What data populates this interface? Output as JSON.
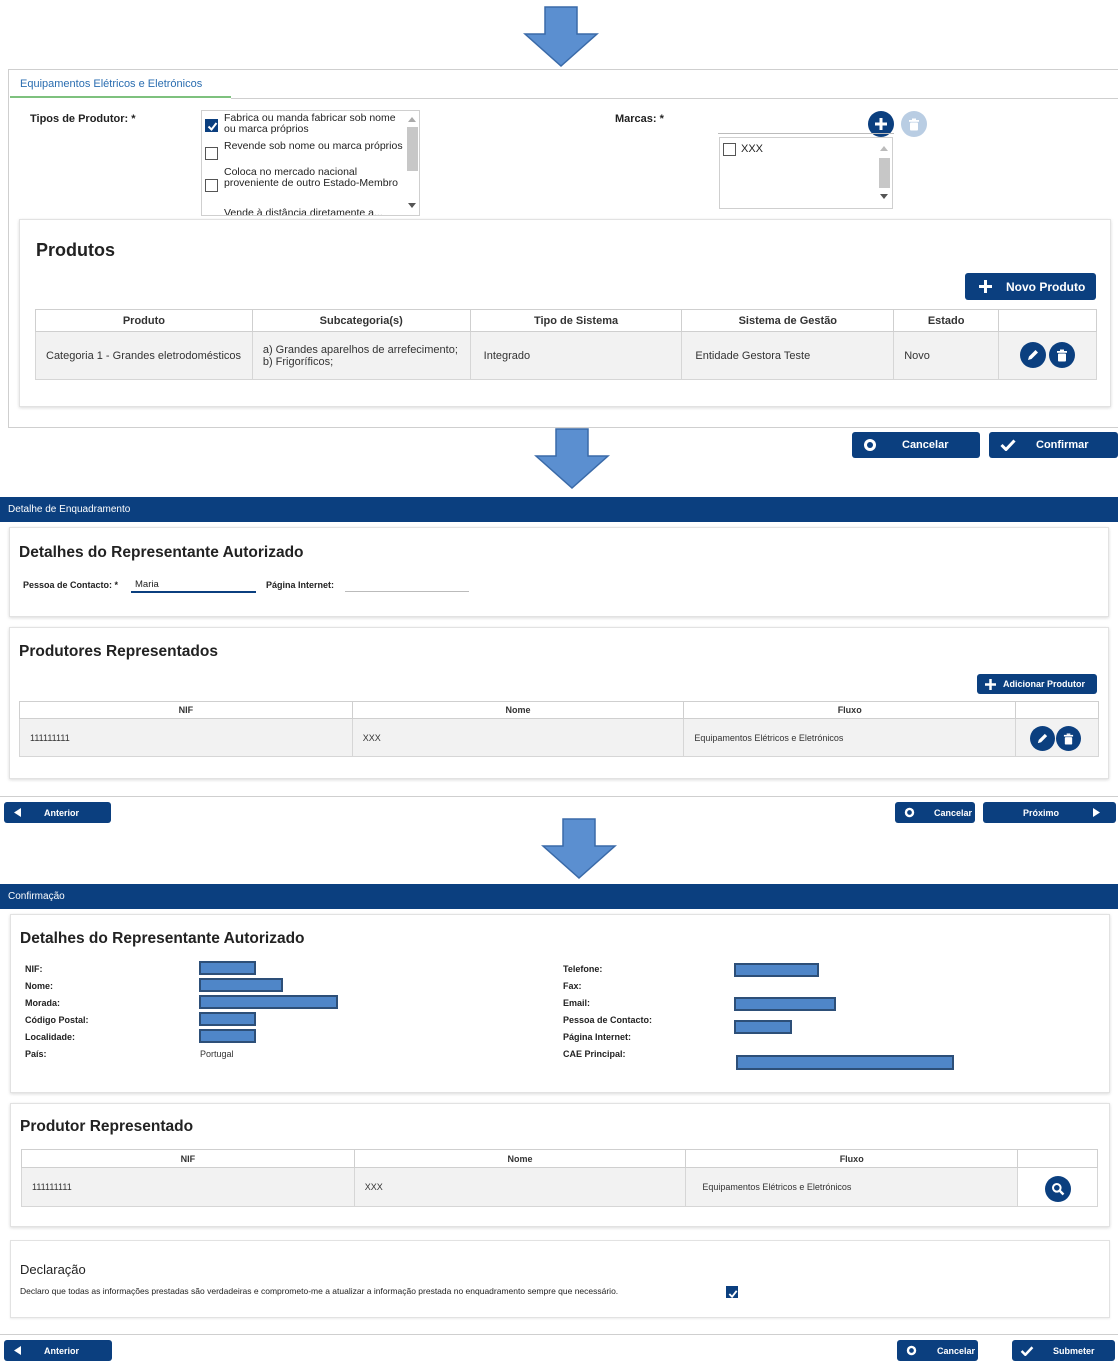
{
  "colors": {
    "navy": "#0b3f7f",
    "arrow": "#5b8fd0",
    "redaction": "#4f86c8"
  },
  "step1": {
    "tab_label": "Equipamentos Elétricos e Eletrónicos",
    "tipos_label": "Tipos de Produtor: *",
    "tipos_options": [
      {
        "text": "Fabrica ou manda fabricar sob nome ou marca próprios",
        "checked": true
      },
      {
        "text": "Revende sob nome ou marca próprios",
        "checked": false
      },
      {
        "text": "Coloca no mercado nacional proveniente de outro Estado-Membro",
        "checked": false
      },
      {
        "text": "Vende à distância diretamente a...",
        "checked": false
      }
    ],
    "marcas_label": "Marcas: *",
    "marcas_items": [
      "XXX"
    ],
    "produtos_title": "Produtos",
    "novo_produto_label": "Novo Produto",
    "produtos_table": {
      "headers": [
        "Produto",
        "Subcategoria(s)",
        "Tipo de Sistema",
        "Sistema de Gestão",
        "Estado"
      ],
      "rows": [
        [
          "Categoria 1 - Grandes eletrodomésticos",
          "a) Grandes aparelhos de arrefecimento; b) Frigoríficos;",
          "Integrado",
          "Entidade Gestora Teste",
          "Novo"
        ]
      ]
    },
    "cancelar_label": "Cancelar",
    "confirmar_label": "Confirmar"
  },
  "step2": {
    "bar_title": "Detalhe de Enquadramento",
    "rep_title": "Detalhes do Representante Autorizado",
    "contacto_label": "Pessoa de Contacto: *",
    "contacto_value": "Maria",
    "pagina_label": "Página Internet:",
    "pagina_value": "",
    "produtores_title": "Produtores Representados",
    "adicionar_label": "Adicionar Produtor",
    "table": {
      "headers": [
        "NIF",
        "Nome",
        "Fluxo"
      ],
      "rows": [
        [
          "111111111",
          "XXX",
          "Equipamentos Elétricos e Eletrónicos"
        ]
      ]
    },
    "anterior_label": "Anterior",
    "cancelar_label": "Cancelar",
    "proximo_label": "Próximo"
  },
  "step3": {
    "bar_title": "Confirmação",
    "rep_title": "Detalhes do Representante Autorizado",
    "left_labels": [
      "NIF:",
      "Nome:",
      "Morada:",
      "Código Postal:",
      "Localidade:",
      "País:"
    ],
    "pais_value": "Portugal",
    "right_labels": [
      "Telefone:",
      "Fax:",
      "Email:",
      "Pessoa de Contacto:",
      "Página Internet:",
      "CAE Principal:"
    ],
    "produtor_title": "Produtor Representado",
    "table": {
      "headers": [
        "NIF",
        "Nome",
        "Fluxo"
      ],
      "rows": [
        [
          "111111111",
          "XXX",
          "Equipamentos Elétricos e Eletrónicos"
        ]
      ]
    },
    "declaracao_title": "Declaração",
    "declaracao_text": "Declaro que todas as informações prestadas são verdadeiras e comprometo-me a atualizar a informação prestada no enquadramento sempre que necessário.",
    "declaracao_checked": true,
    "anterior_label": "Anterior",
    "cancelar_label": "Cancelar",
    "submeter_label": "Submeter"
  }
}
